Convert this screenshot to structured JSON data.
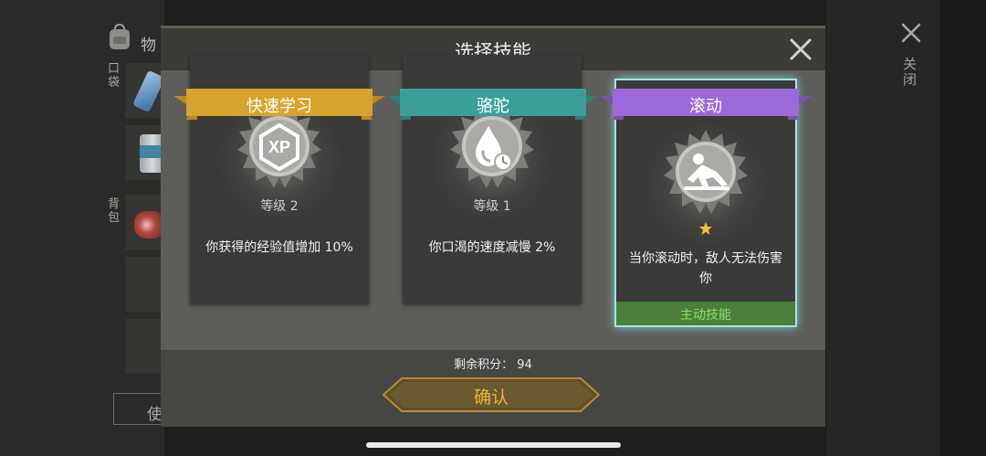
{
  "background": {
    "inventory_title": "物",
    "pocket_label": "口袋",
    "backpack_label": "背包",
    "use_button_label": "使",
    "close_label": "关闭"
  },
  "dialog": {
    "title": "选择技能",
    "remaining_points_label": "剩余积分：",
    "remaining_points_value": "94",
    "confirm_label": "确认"
  },
  "skills": [
    {
      "name": "快速学习",
      "level": "等级 2",
      "description": "你获得的经验值增加 10%",
      "ribbon_color": "#d6a32c",
      "icon": "xp-icon"
    },
    {
      "name": "骆驼",
      "level": "等级 1",
      "description": "你口渴的速度减慢 2%",
      "ribbon_color": "#3b9f97",
      "icon": "water-drop-timer-icon"
    },
    {
      "name": "滚动",
      "stars": 1,
      "description": "当你滚动时，敌人无法伤害你",
      "tag": "主动技能",
      "ribbon_color": "#9a6ad8",
      "icon": "rolling-person-icon",
      "selected": true
    }
  ],
  "colors": {
    "accent_gold": "#e7b638",
    "active_green": "#8be35f",
    "selection_glow": "#9ee7e2"
  }
}
